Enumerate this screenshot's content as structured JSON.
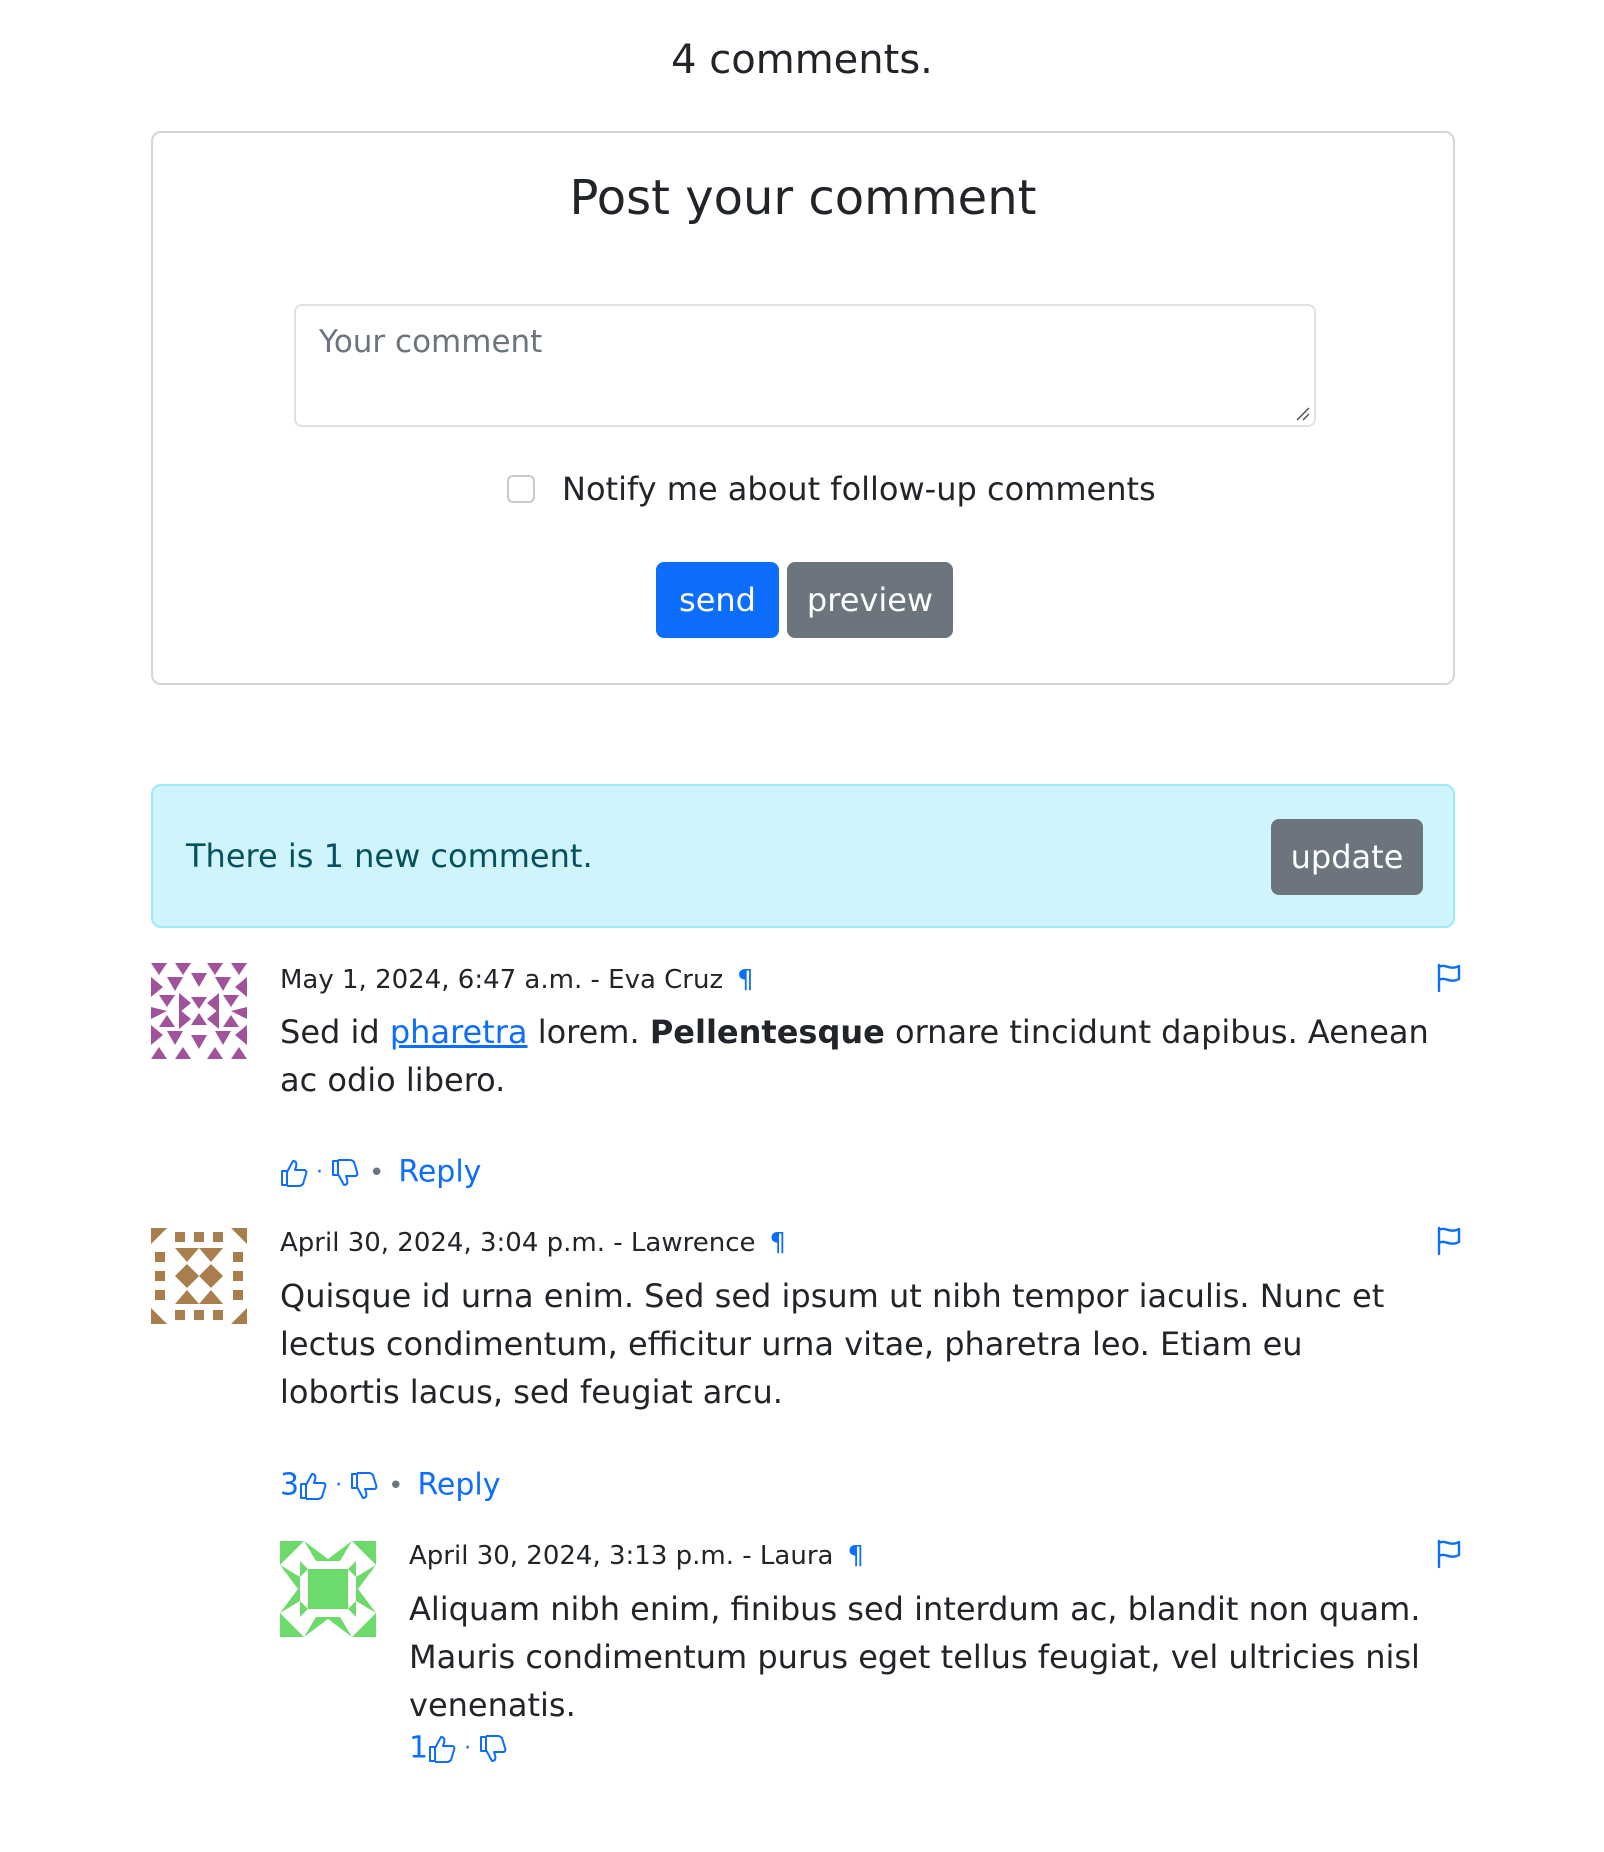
{
  "header": {
    "count_title": "4 comments."
  },
  "post_form": {
    "title": "Post your comment",
    "comment_placeholder": "Your comment",
    "notify_label": "Notify me about follow-up comments",
    "send_label": "send",
    "preview_label": "preview"
  },
  "alert": {
    "text": "There is 1 new comment.",
    "update_label": "update"
  },
  "colors": {
    "primary": "#0d6efd",
    "secondary": "#6c757d",
    "alert_bg": "#cff4fc",
    "alert_text": "#055160"
  },
  "comments": [
    {
      "meta": "May 1, 2024, 6:47 a.m. - Eva Cruz",
      "permalink": "¶",
      "text_before": "Sed id ",
      "link_text": "pharetra",
      "text_middle": " lorem. ",
      "bold_text": "Pellentesque",
      "text_after": " ornare tincidunt dapibus. Aenean ac odio libero.",
      "likes": "",
      "reply_label": "Reply",
      "avatar_color": "#a0529b"
    },
    {
      "meta": "April 30, 2024, 3:04 p.m. - Lawrence",
      "permalink": "¶",
      "text": "Quisque id urna enim. Sed sed ipsum ut nibh tempor iaculis. Nunc et lectus condimentum, efficitur urna vitae, pharetra leo. Etiam eu lobortis lacus, sed feugiat arcu.",
      "likes": "3",
      "reply_label": "Reply",
      "avatar_color": "#a87f4c"
    },
    {
      "meta": "April 30, 2024, 3:13 p.m. - Laura",
      "permalink": "¶",
      "text": "Aliquam nibh enim, finibus sed interdum ac, blandit non quam. Mauris condimentum purus eget tellus feugiat, vel ultricies nisl venenatis.",
      "likes": "1",
      "avatar_color": "#6cdb6c"
    }
  ],
  "icons": {
    "like": "thumbs-up-icon",
    "dislike": "thumbs-down-icon",
    "flag": "flag-icon",
    "separator": "·",
    "bullet": "•"
  }
}
